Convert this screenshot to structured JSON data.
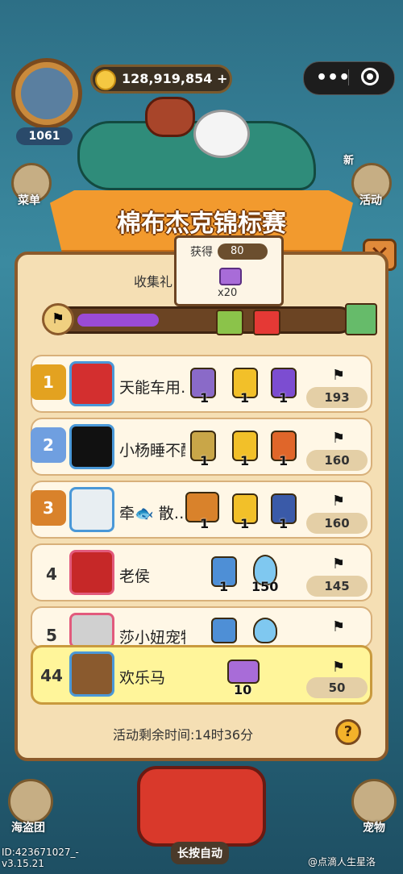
{
  "hud": {
    "level": "1061",
    "coins": "128,919,854",
    "coin_plus": "+",
    "left_menu_label": "菜单",
    "right_menu_label": "活动",
    "right_menu_badge": "新"
  },
  "banner": {
    "title": "棉布杰克锦标赛"
  },
  "collect": {
    "label": "收集礼",
    "progress": 0.3,
    "tooltip_label": "获得",
    "tooltip_value": "80",
    "tooltip_qty": "x20"
  },
  "rows": [
    {
      "rank": "1",
      "name": "天能车用…",
      "rewards": [
        "1",
        "1",
        "1"
      ],
      "score": "193",
      "medal_color": "#e3a220"
    },
    {
      "rank": "2",
      "name": "小杨睡不醒",
      "rewards": [
        "1",
        "1",
        "1"
      ],
      "score": "160",
      "medal_color": "#6f9fe0"
    },
    {
      "rank": "3",
      "name": "牵🐟 散…",
      "rewards": [
        "1",
        "1",
        "1"
      ],
      "score": "160",
      "medal_color": "#d9822b"
    },
    {
      "rank": "4",
      "name": "老侯",
      "rewards": [
        "1",
        "150"
      ],
      "score": "145"
    },
    {
      "rank": "5",
      "name": "莎小妞宠物",
      "rewards": [],
      "score": ""
    }
  ],
  "me": {
    "rank": "44",
    "name": "欢乐马",
    "reward": "10",
    "score": "50"
  },
  "time_remaining": "活动剩余时间:14时36分",
  "help_label": "?",
  "close_label": "✕",
  "bottom": {
    "left_label": "海盗团",
    "right_label": "宠物",
    "center_label": "长按自动"
  },
  "footer": {
    "id_line1": "ID:423671027_-",
    "id_line2": "v3.15.21",
    "watermark": "@点滴人生星洛"
  }
}
